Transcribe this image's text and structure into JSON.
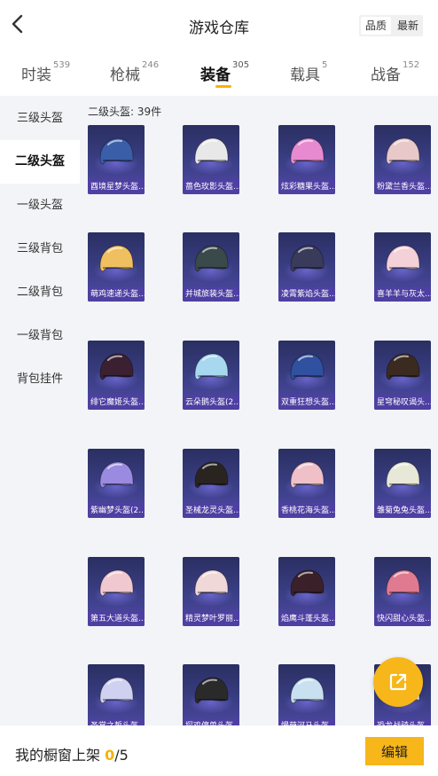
{
  "header": {
    "title": "游戏仓库",
    "sort_options": [
      "品质",
      "最新"
    ]
  },
  "tabs": [
    {
      "label": "时装",
      "count": "539"
    },
    {
      "label": "枪械",
      "count": "246"
    },
    {
      "label": "装备",
      "count": "305"
    },
    {
      "label": "载具",
      "count": "5"
    },
    {
      "label": "战备",
      "count": "152"
    }
  ],
  "sidebar": {
    "items": [
      "三级头盔",
      "二级头盔",
      "一级头盔",
      "三级背包",
      "二级背包",
      "一级背包",
      "背包挂件"
    ]
  },
  "content": {
    "section_title": "二级头盔: 39件",
    "items": [
      {
        "name": "酉境星梦头盔...",
        "color": "#3a5ea8"
      },
      {
        "name": "蔷色玫影头盔...",
        "color": "#e8e8e8"
      },
      {
        "name": "炫彩糖果头盔...",
        "color": "#e88ad0"
      },
      {
        "name": "粉黛兰香头盔...",
        "color": "#e8c8c8"
      },
      {
        "name": "萌鸡速递头盔...",
        "color": "#f0c060"
      },
      {
        "name": "并城旅装头盔...",
        "color": "#3a4a4a"
      },
      {
        "name": "凌霄紫焰头盔...",
        "color": "#3a3a5a"
      },
      {
        "name": "喜羊羊与灰太...",
        "color": "#f4d0d8"
      },
      {
        "name": "绯它魔姬头盔...",
        "color": "#3a2030"
      },
      {
        "name": "云朵鹅头盔(2...",
        "color": "#a8d8f0"
      },
      {
        "name": "双重狂想头盔...",
        "color": "#3050a0"
      },
      {
        "name": "星穹秘叹谒头...",
        "color": "#3a2a20"
      },
      {
        "name": "紫幽梦头盔(2...",
        "color": "#9a8ae0"
      },
      {
        "name": "圣械龙灵头盔...",
        "color": "#2a2420"
      },
      {
        "name": "香桃花海头盔...",
        "color": "#f0c0c8"
      },
      {
        "name": "雏菊兔兔头盔...",
        "color": "#e8e8d8"
      },
      {
        "name": "第五大道头盔...",
        "color": "#f0c8d0"
      },
      {
        "name": "精灵梦叶罗丽...",
        "color": "#f0d8d8"
      },
      {
        "name": "焰鹰斗蓬头盔...",
        "color": "#3a2028"
      },
      {
        "name": "快闪甜心头盔...",
        "color": "#e07a90"
      },
      {
        "name": "圣堂之誓头盔...",
        "color": "#d0d0f0"
      },
      {
        "name": "探鸡停兽头盔...",
        "color": "#2a2a2a"
      },
      {
        "name": "慢萌河马头盔...",
        "color": "#c8e0f0"
      },
      {
        "name": "恐龙战骑头盔...",
        "color": "#e8e8e8"
      }
    ]
  },
  "bottom": {
    "label": "我的橱窗上架 ",
    "count": "0",
    "total": "/5",
    "edit_label": "编辑"
  },
  "colors": {
    "accent": "#f7b619",
    "card_bg": "#3b3f86",
    "label_bg": "#4e3fa2"
  }
}
